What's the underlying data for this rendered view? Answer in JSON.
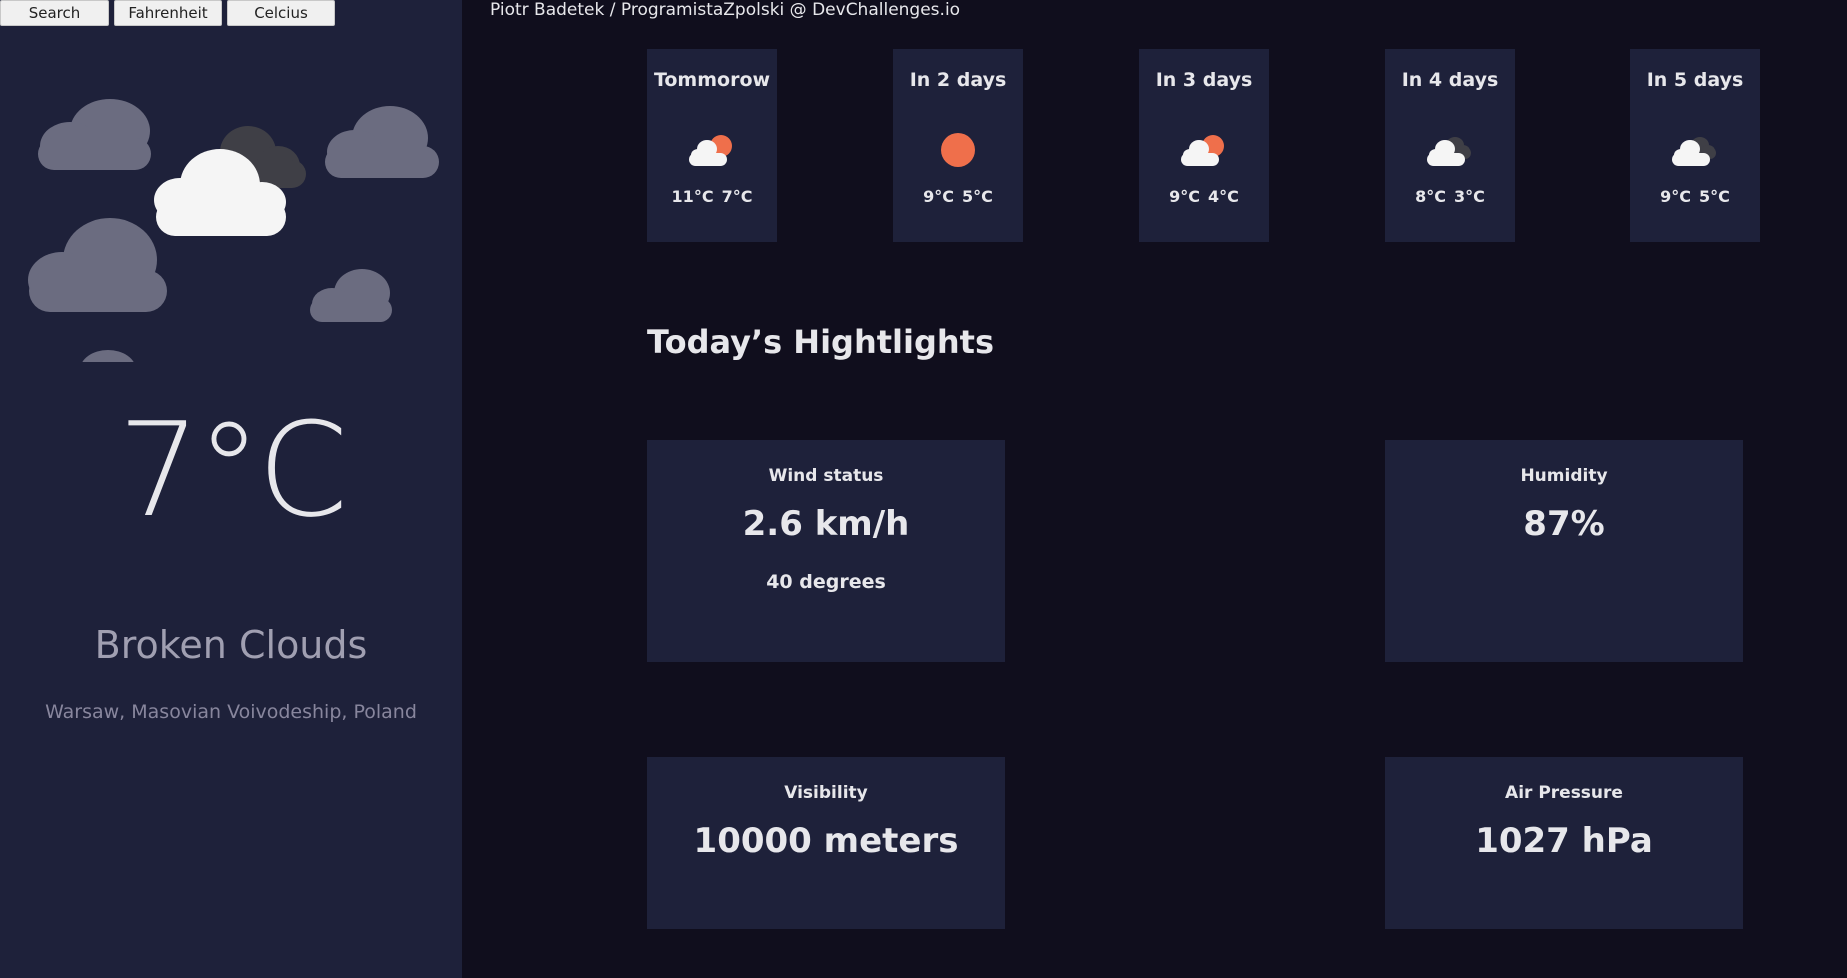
{
  "toolbar": {
    "search_label": "Search",
    "fahrenheit_label": "Fahrenheit",
    "celsius_label": "Celcius"
  },
  "current": {
    "temperature": "7°C",
    "condition": "Broken Clouds",
    "location": "Warsaw, Masovian Voivodeship, Poland"
  },
  "credit": "Piotr Badetek / ProgramistaZpolski @ DevChallenges.io",
  "forecast": [
    {
      "day": "Tommorow",
      "max": "11°C",
      "min": "7°C",
      "icon": "partly-cloudy-icon"
    },
    {
      "day": "In 2 days",
      "max": "9°C",
      "min": "5°C",
      "icon": "sun-icon"
    },
    {
      "day": "In 3 days",
      "max": "9°C",
      "min": "4°C",
      "icon": "partly-cloudy-icon"
    },
    {
      "day": "In 4 days",
      "max": "8°C",
      "min": "3°C",
      "icon": "broken-clouds-icon"
    },
    {
      "day": "In 5 days",
      "max": "9°C",
      "min": "5°C",
      "icon": "broken-clouds-icon"
    }
  ],
  "highlights": {
    "title": "Today’s Hightlights",
    "wind": {
      "label": "Wind status",
      "value": "2.6 km/h",
      "sub": "40 degrees"
    },
    "humidity": {
      "label": "Humidity",
      "value": "87%"
    },
    "visibility": {
      "label": "Visibility",
      "value": "10000 meters"
    },
    "pressure": {
      "label": "Air Pressure",
      "value": "1027 hPa"
    }
  },
  "colors": {
    "sidebar_bg": "#1e213a",
    "main_bg": "#100e1d",
    "sun": "#ef6f4b",
    "cloud_white": "#f5f5f5",
    "cloud_dark": "#3f3f46",
    "cloud_grey": "#6b6c80"
  }
}
